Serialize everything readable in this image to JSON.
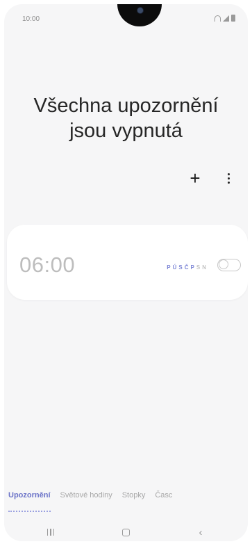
{
  "status_bar": {
    "time": "10:00"
  },
  "headline": {
    "line1": "Všechna upozornění",
    "line2": "jsou vypnutá"
  },
  "toolbar": {
    "add_icon": "plus-icon",
    "more_icon": "kebab-icon"
  },
  "alarm": {
    "time": "06:00",
    "days": [
      "P",
      "Ú",
      "S",
      "Č",
      "P",
      "S",
      "N"
    ],
    "enabled": false
  },
  "tabs": [
    {
      "label": "Upozornění",
      "active": true
    },
    {
      "label": "Světové hodiny",
      "active": false
    },
    {
      "label": "Stopky",
      "active": false
    },
    {
      "label": "Časc",
      "active": false
    }
  ],
  "navigation": {
    "recents_icon": "recents-icon",
    "home_icon": "home-icon",
    "back_icon": "back-icon"
  }
}
